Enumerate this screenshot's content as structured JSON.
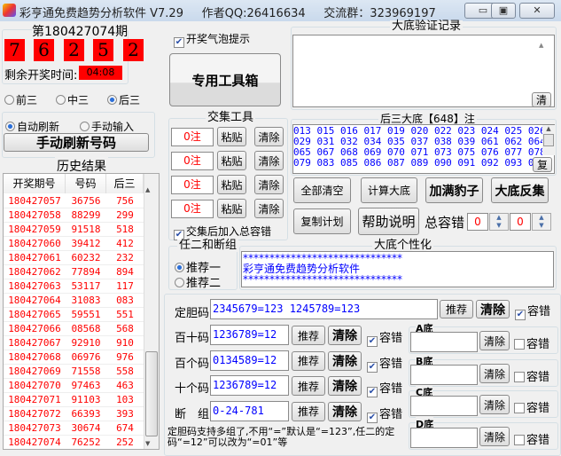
{
  "window": {
    "title": "彩亨通免费趋势分析软件 V7.29     作者QQ:26416634     交流群：323969197",
    "minimize": "▭",
    "maximize": "▣",
    "close": "✕"
  },
  "draw": {
    "period": "第180427074期",
    "digits": [
      "7",
      "6",
      "2",
      "5",
      "2"
    ],
    "countdown_label": "剩余开奖时间:",
    "countdown": "04:08"
  },
  "position_radios": [
    {
      "label": "前三",
      "checked": false
    },
    {
      "label": "中三",
      "checked": false
    },
    {
      "label": "后三",
      "checked": true
    }
  ],
  "refresh": {
    "auto": "自动刷新",
    "manual": "手动输入",
    "auto_checked": true,
    "button": "手动刷新号码"
  },
  "history": {
    "title": "历史结果",
    "headers": [
      "开奖期号",
      "号码",
      "后三"
    ],
    "rows": [
      [
        "180427057",
        "36756",
        "756"
      ],
      [
        "180427058",
        "88299",
        "299"
      ],
      [
        "180427059",
        "91518",
        "518"
      ],
      [
        "180427060",
        "39412",
        "412"
      ],
      [
        "180427061",
        "60232",
        "232"
      ],
      [
        "180427062",
        "77894",
        "894"
      ],
      [
        "180427063",
        "53117",
        "117"
      ],
      [
        "180427064",
        "31083",
        "083"
      ],
      [
        "180427065",
        "59551",
        "551"
      ],
      [
        "180427066",
        "08568",
        "568"
      ],
      [
        "180427067",
        "92910",
        "910"
      ],
      [
        "180427068",
        "06976",
        "976"
      ],
      [
        "180427069",
        "71558",
        "558"
      ],
      [
        "180427070",
        "97463",
        "463"
      ],
      [
        "180427071",
        "91103",
        "103"
      ],
      [
        "180427072",
        "66393",
        "393"
      ],
      [
        "180427073",
        "30674",
        "674"
      ],
      [
        "180427074",
        "76252",
        "252"
      ]
    ]
  },
  "bubble_tip": {
    "label": "开奖气泡提示",
    "checked": true
  },
  "toolbox_button": "专用工具箱",
  "intersect": {
    "title": "交集工具",
    "rows": [
      {
        "value": "0注",
        "paste": "粘贴",
        "clear": "清除"
      },
      {
        "value": "0注",
        "paste": "粘贴",
        "clear": "清除"
      },
      {
        "value": "0注",
        "paste": "粘贴",
        "clear": "清除"
      },
      {
        "value": "0注",
        "paste": "粘贴",
        "clear": "清除"
      }
    ],
    "add_total": {
      "label": "交集后加入总容错",
      "checked": true
    }
  },
  "ren2": {
    "title": "任二和断组",
    "options": [
      {
        "label": "推荐一",
        "checked": true
      },
      {
        "label": "推荐二",
        "checked": false
      }
    ]
  },
  "verify": {
    "title": "大底验证记录",
    "text": "",
    "clear": "清"
  },
  "base": {
    "title": "后三大底【648】注",
    "lines": [
      "013 015 016 017 019 020 022 023 024 025 026",
      "029 031 032 034 035 037 038 039 061 062 064",
      "065 067 068 069 070 071 073 075 076 077 078",
      "079 083 085 086 087 089 090 091 092 093 094"
    ],
    "copy": "复"
  },
  "actions": {
    "clear_all": "全部清空",
    "calc": "计算大底",
    "add_leopard": "加满豹子",
    "inverse": "大底反集",
    "copy_plan": "复制计划",
    "help": "帮助说明",
    "total_tolerance": "总容错",
    "tol1": "0",
    "tol2": "0"
  },
  "custom": {
    "title": "大底个性化",
    "lines": [
      "******************************",
      "彩亨通免费趋势分析软件",
      "******************************"
    ]
  },
  "filters": {
    "rows": [
      {
        "label": "定胆码",
        "value": "2345679=123 1245789=123",
        "recommend": "推荐",
        "clear": "清除",
        "tol": "容错",
        "checked": true
      },
      {
        "label": "百十码",
        "value": "1236789=12",
        "recommend": "推荐",
        "clear": "清除",
        "tol": "容错",
        "checked": true
      },
      {
        "label": "百个码",
        "value": "0134589=12",
        "recommend": "推荐",
        "clear": "清除",
        "tol": "容错",
        "checked": true
      },
      {
        "label": "十个码",
        "value": "1236789=12",
        "recommend": "推荐",
        "clear": "清除",
        "tol": "容错",
        "checked": true
      },
      {
        "label": "断　组",
        "value": "0-24-781",
        "recommend": "推荐",
        "clear": "清除",
        "tol": "容错",
        "checked": true
      }
    ],
    "note": "定胆码支持多组了,不用“=”默认是“=123”,任二的定码“=12”可以改为“=01”等"
  },
  "bases": [
    {
      "label": "A底",
      "value": "",
      "clear": "清除",
      "tol": "容错",
      "checked": false
    },
    {
      "label": "B底",
      "value": "",
      "clear": "清除",
      "tol": "容错",
      "checked": false
    },
    {
      "label": "C底",
      "value": "",
      "clear": "清除",
      "tol": "容错",
      "checked": false
    },
    {
      "label": "D底",
      "value": "",
      "clear": "清除",
      "tol": "容错",
      "checked": false
    }
  ]
}
